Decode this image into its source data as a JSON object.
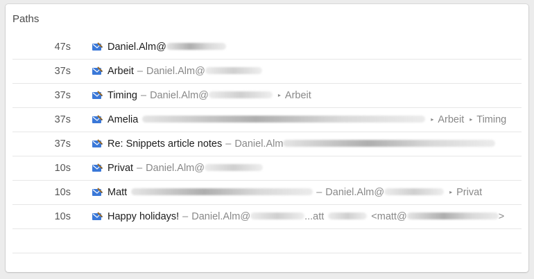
{
  "panel": {
    "title": "Paths"
  },
  "colors": {
    "primary_text": "#1c1c1c",
    "secondary_text": "#888888",
    "divider": "#e6e6e6",
    "icon_blue": "#3a78d8"
  },
  "rows": [
    {
      "duration": "47s",
      "title": "Daniel.Alm@"
    },
    {
      "duration": "37s",
      "title": "Arbeit",
      "account": "Daniel.Alm@"
    },
    {
      "duration": "37s",
      "title": "Timing",
      "account": "Daniel.Alm@",
      "folder": "Arbeit"
    },
    {
      "duration": "37s",
      "title": "Amelia",
      "folder": "Arbeit",
      "subfolder": "Timing"
    },
    {
      "duration": "37s",
      "title": "Re: Snippets article notes",
      "account": "Daniel.Alm"
    },
    {
      "duration": "10s",
      "title": "Privat",
      "account": "Daniel.Alm@"
    },
    {
      "duration": "10s",
      "title": "Matt",
      "account": "Daniel.Alm@",
      "folder": "Privat"
    },
    {
      "duration": "10s",
      "title": "Happy holidays!",
      "account": "Daniel.Alm@",
      "account_tail": "...att",
      "recipient": "<matt@",
      "recipient_end": ">"
    }
  ],
  "separators": {
    "dash": "–",
    "arrow": "▸"
  },
  "icons": {
    "row_icon": "mail-app-icon"
  }
}
